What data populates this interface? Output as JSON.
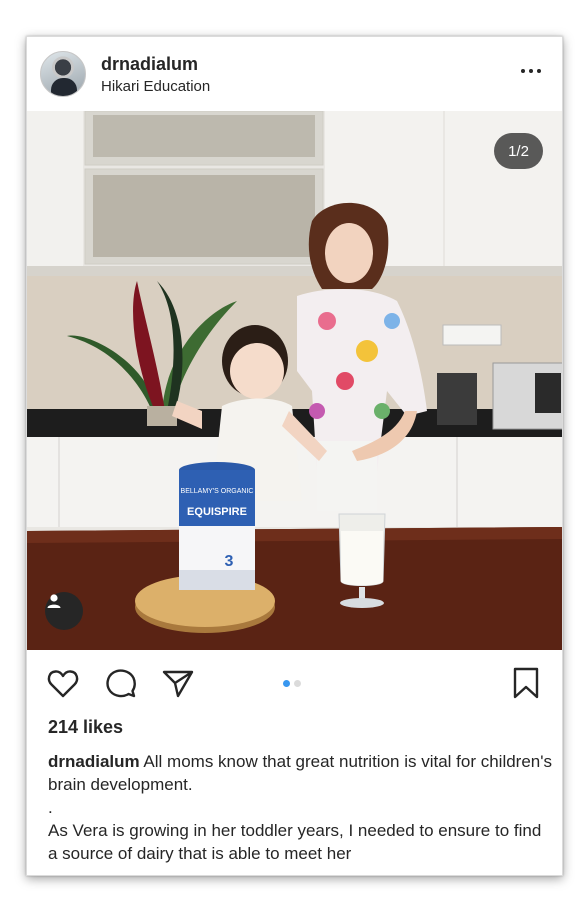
{
  "post": {
    "username": "drnadialum",
    "location": "Hikari Education",
    "image_counter": "1/2",
    "likes": "214 likes",
    "caption_lines": [
      "All moms know that great nutrition is vital for children's brain development.",
      ".",
      "As Vera is growing in her toddler years, I needed to ensure to find a source of dairy that is able to meet her"
    ]
  },
  "product": {
    "brand": "BELLAMY'S ORGANIC",
    "name": "EQUISPIRE",
    "step": "3"
  },
  "carousel": {
    "current": 1,
    "total": 2
  },
  "colors": {
    "text": "#262626",
    "active_dot": "#3897f0",
    "inactive_dot": "#dbdbdb"
  },
  "icons": [
    "more-options-icon",
    "user-tag-icon",
    "heart-icon",
    "comment-icon",
    "share-icon",
    "bookmark-icon"
  ]
}
